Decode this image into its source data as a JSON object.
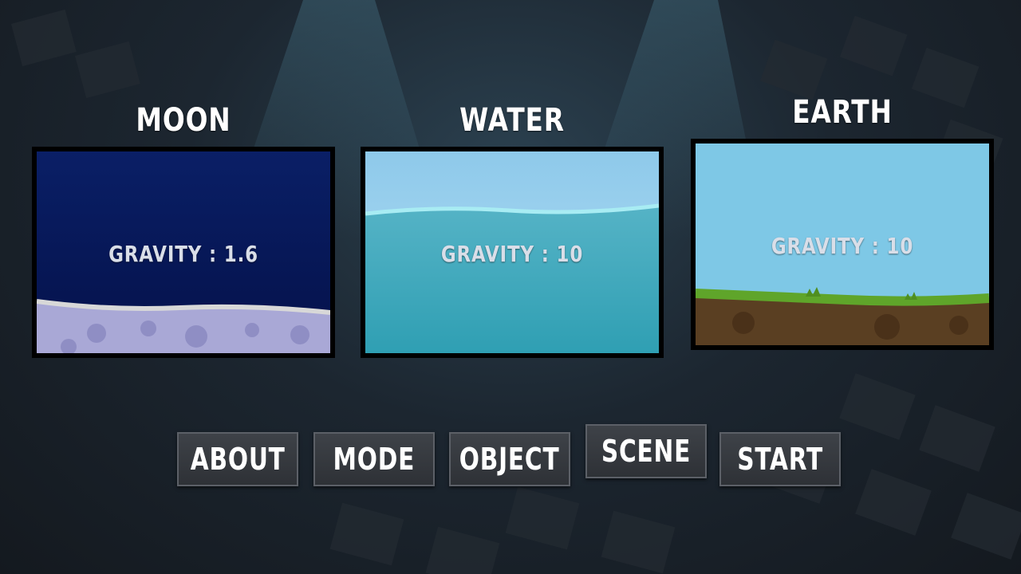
{
  "scenes": [
    {
      "title": "MOON",
      "gravity_text": "GRAVITY : 1.6"
    },
    {
      "title": "WATER",
      "gravity_text": "GRAVITY : 10"
    },
    {
      "title": "EARTH",
      "gravity_text": "GRAVITY : 10"
    }
  ],
  "menu": {
    "about": "ABOUT",
    "mode": "MODE",
    "object": "OBJECT",
    "scene": "SCENE",
    "start": "START"
  },
  "colors": {
    "moon_sky": "#061a5e",
    "moon_ground": "#a9a8d6",
    "water_sky": "#9fd3ef",
    "water": "#3ea6b8",
    "earth_sky": "#7ec8e6",
    "earth_grass": "#5fa52a",
    "earth_soil": "#5a3f22",
    "button_bg": "#35383d"
  }
}
